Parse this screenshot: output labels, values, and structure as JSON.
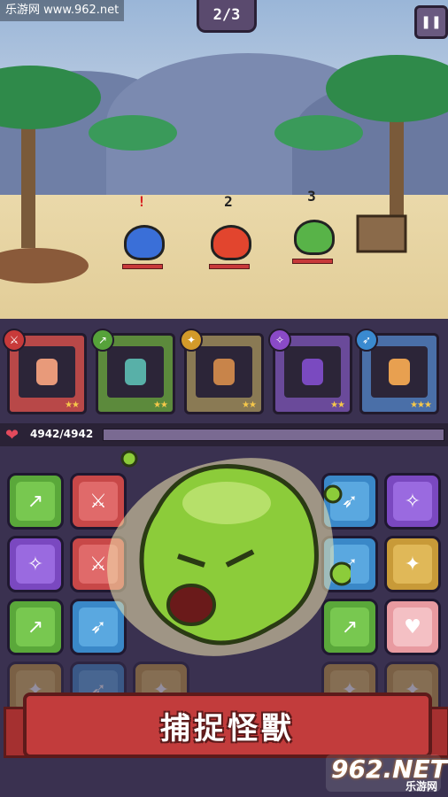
{
  "watermark": "乐游网 www.962.net",
  "wave_counter": "2/3",
  "pause_icon": "pause-icon",
  "enemies": [
    {
      "tag": "!",
      "name": "blue-shell",
      "color": "#3a6fd8"
    },
    {
      "tag": "2",
      "name": "red-crab",
      "color": "#e2452e"
    },
    {
      "tag": "3",
      "name": "green-turtle",
      "color": "#58b348"
    }
  ],
  "heroes": [
    {
      "weapon": "sword-icon",
      "weapon_color": "#c83a3a",
      "bg": "#b84848",
      "face": "#e89a7a",
      "stars": "★★"
    },
    {
      "weapon": "spear-icon",
      "weapon_color": "#56a23a",
      "bg": "#5c8a3c",
      "face": "#58b0a8",
      "stars": "★★"
    },
    {
      "weapon": "axe-icon",
      "weapon_color": "#d39a2a",
      "bg": "#8a7a54",
      "face": "#c8844a",
      "stars": "★★"
    },
    {
      "weapon": "staff-icon",
      "weapon_color": "#8a4ac8",
      "bg": "#6a4a9a",
      "face": "#7a4ac0",
      "stars": "★★"
    },
    {
      "weapon": "bow-icon",
      "weapon_color": "#3a8ad0",
      "bg": "#4a6fa8",
      "face": "#e8a050",
      "stars": "★★★"
    }
  ],
  "hp": {
    "current_text": "4942/4942",
    "fraction": 1.0
  },
  "board": [
    [
      "spear",
      "sword",
      "",
      "",
      "",
      "bow",
      "staff"
    ],
    [
      "staff",
      "sword",
      "",
      "",
      "",
      "bow",
      "axe"
    ],
    [
      "spear",
      "bow",
      "",
      "",
      "",
      "spear",
      "heart"
    ],
    [
      "axe",
      "bow",
      "axe",
      "",
      "",
      "axe",
      "axe"
    ]
  ],
  "banner_title": "捕捉怪獸",
  "logo": {
    "number": "962.NET",
    "caption": "乐游网"
  }
}
